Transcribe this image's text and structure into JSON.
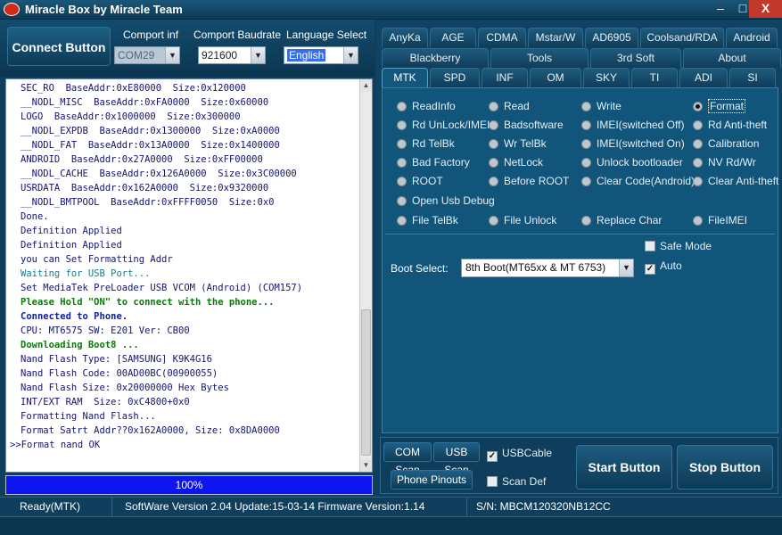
{
  "window": {
    "title": "Miracle Box by Miracle Team",
    "min": "–",
    "max": "□",
    "close": "X"
  },
  "top": {
    "connect_button": "Connect Button",
    "comport_label": "Comport inf",
    "comport_value": "COM29",
    "baud_label": "Comport Baudrate",
    "baud_value": "921600",
    "lang_label": "Language Select",
    "lang_value": "English"
  },
  "log": [
    {
      "text": "SEC_RO  BaseAddr:0xE80000  Size:0x120000",
      "style": ""
    },
    {
      "text": "__NODL_MISC  BaseAddr:0xFA0000  Size:0x60000",
      "style": ""
    },
    {
      "text": "LOGO  BaseAddr:0x1000000  Size:0x300000",
      "style": ""
    },
    {
      "text": "__NODL_EXPDB  BaseAddr:0x1300000  Size:0xA0000",
      "style": ""
    },
    {
      "text": "__NODL_FAT  BaseAddr:0x13A0000  Size:0x1400000",
      "style": ""
    },
    {
      "text": "ANDROID  BaseAddr:0x27A0000  Size:0xFF00000",
      "style": ""
    },
    {
      "text": "__NODL_CACHE  BaseAddr:0x126A0000  Size:0x3C00000",
      "style": ""
    },
    {
      "text": "USRDATA  BaseAddr:0x162A0000  Size:0x9320000",
      "style": ""
    },
    {
      "text": "__NODL_BMTPOOL  BaseAddr:0xFFFF0050  Size:0x0",
      "style": ""
    },
    {
      "text": "Done.",
      "style": ""
    },
    {
      "text": "Definition Applied",
      "style": ""
    },
    {
      "text": "Definition Applied",
      "style": ""
    },
    {
      "text": "you can Set Formatting Addr",
      "style": ""
    },
    {
      "text": "Waiting for USB Port...",
      "style": "hl-teal"
    },
    {
      "text": "Set MediaTek PreLoader USB VCOM (Android) (COM157)",
      "style": ""
    },
    {
      "text": "Please Hold \"ON\" to connect with the phone...",
      "style": "hl-green"
    },
    {
      "text": "Connected to Phone.",
      "style": "hl-blue"
    },
    {
      "text": "CPU: MT6575 SW: E201 Ver: CB00",
      "style": ""
    },
    {
      "text": "Downloading Boot8 ...",
      "style": "hl-green"
    },
    {
      "text": "Nand Flash Type: [SAMSUNG] K9K4G16",
      "style": ""
    },
    {
      "text": "Nand Flash Code: 00AD00BC(00900055)",
      "style": ""
    },
    {
      "text": "Nand Flash Size: 0x20000000 Hex Bytes",
      "style": ""
    },
    {
      "text": "INT/EXT RAM  Size: 0xC4800+0x0",
      "style": ""
    },
    {
      "text": "Formatting Nand Flash...",
      "style": ""
    },
    {
      "text": "Format Satrt Addr??0x162A0000, Size: 0x8DA0000",
      "style": ""
    },
    {
      "text": ">>Format nand OK",
      "style": "prompt"
    }
  ],
  "progress": {
    "label": "100%",
    "value": 1.0
  },
  "tabs_row1": [
    "AnyKa",
    "AGE",
    "CDMA",
    "Mstar/W",
    "AD6905",
    "Coolsand/RDA",
    "Android"
  ],
  "tabs_row2": [
    "Blackberry",
    "Tools",
    "3rd Soft",
    "About"
  ],
  "tabs_row3": [
    "MTK",
    "SPD",
    "INF",
    "OM",
    "SKY",
    "TI",
    "ADI",
    "SI"
  ],
  "active_tab": "MTK",
  "options": [
    {
      "label": "ReadInfo",
      "checked": false
    },
    {
      "label": "Read",
      "checked": false
    },
    {
      "label": "Write",
      "checked": false
    },
    {
      "label": "Format",
      "checked": true
    },
    {
      "label": "Rd UnLock/IMEI",
      "checked": false
    },
    {
      "label": "Badsoftware",
      "checked": false
    },
    {
      "label": "IMEI(switched Off)",
      "checked": false
    },
    {
      "label": "Rd Anti-theft",
      "checked": false
    },
    {
      "label": "Rd TelBk",
      "checked": false
    },
    {
      "label": "Wr TelBk",
      "checked": false
    },
    {
      "label": "IMEI(switched On)",
      "checked": false
    },
    {
      "label": "Calibration",
      "checked": false
    },
    {
      "label": "Bad Factory",
      "checked": false
    },
    {
      "label": "NetLock",
      "checked": false
    },
    {
      "label": "Unlock bootloader",
      "checked": false
    },
    {
      "label": "NV Rd/Wr",
      "checked": false
    },
    {
      "label": "ROOT",
      "checked": false
    },
    {
      "label": "Before ROOT",
      "checked": false
    },
    {
      "label": "Clear Code(Android)",
      "checked": false
    },
    {
      "label": "Clear Anti-theft",
      "checked": false
    },
    {
      "label": "Open Usb Debug",
      "checked": false
    },
    {
      "label": "File TelBk",
      "checked": false
    },
    {
      "label": "File Unlock",
      "checked": false
    },
    {
      "label": "Replace Char",
      "checked": false
    },
    {
      "label": "FileIMEI",
      "checked": false
    }
  ],
  "safe_mode": {
    "label": "Safe Mode",
    "checked": false
  },
  "auto": {
    "label": "Auto",
    "checked": true
  },
  "boot": {
    "label": "Boot Select:",
    "value": "8th Boot(MT65xx & MT 6753)"
  },
  "bottom": {
    "com_scan": "COM Scan",
    "usb_scan": "USB Scan",
    "usbcable": {
      "label": "USBCable",
      "checked": true
    },
    "phone_pinouts": "Phone Pinouts",
    "scan_def": {
      "label": "Scan Def",
      "checked": false
    },
    "start": "Start Button",
    "stop": "Stop Button"
  },
  "status": {
    "state": "Ready(MTK)",
    "version": "SoftWare Version 2.04  Update:15-03-14  Firmware Version:1.14",
    "sn": "S/N: MBCM120320NB12CC"
  }
}
